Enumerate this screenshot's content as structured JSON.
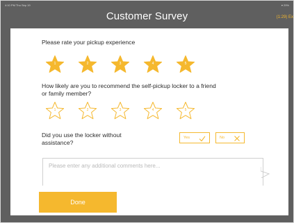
{
  "status_bar": {
    "time_date": "4:10 PM  Thu Sep 19",
    "battery": "29%"
  },
  "header": {
    "title": "Customer Survey",
    "timer": "(1:29) Ex"
  },
  "colors": {
    "accent": "#f5b82e",
    "star_fill": "#f5b82e",
    "background": "#5f5f5f",
    "card": "#ffffff"
  },
  "survey": {
    "q1": {
      "text": "Please rate your pickup experience",
      "rating": 5,
      "max": 5,
      "stars": [
        "1",
        "2",
        "3",
        "4",
        "5"
      ]
    },
    "q2": {
      "text_line1": "How likely are you to recommend the self-pickup locker to a friend",
      "text_line2": "or family member?",
      "rating": 0,
      "max": 5,
      "stars": [
        "1",
        "2",
        "3",
        "4",
        "5"
      ]
    },
    "q3": {
      "text_line1": "Did you use the locker without",
      "text_line2": "assistance?",
      "yes_label": "Yes",
      "no_label": "No"
    },
    "comments": {
      "placeholder": "Please enter any additional comments here...",
      "value": ""
    },
    "done_label": "Done"
  }
}
